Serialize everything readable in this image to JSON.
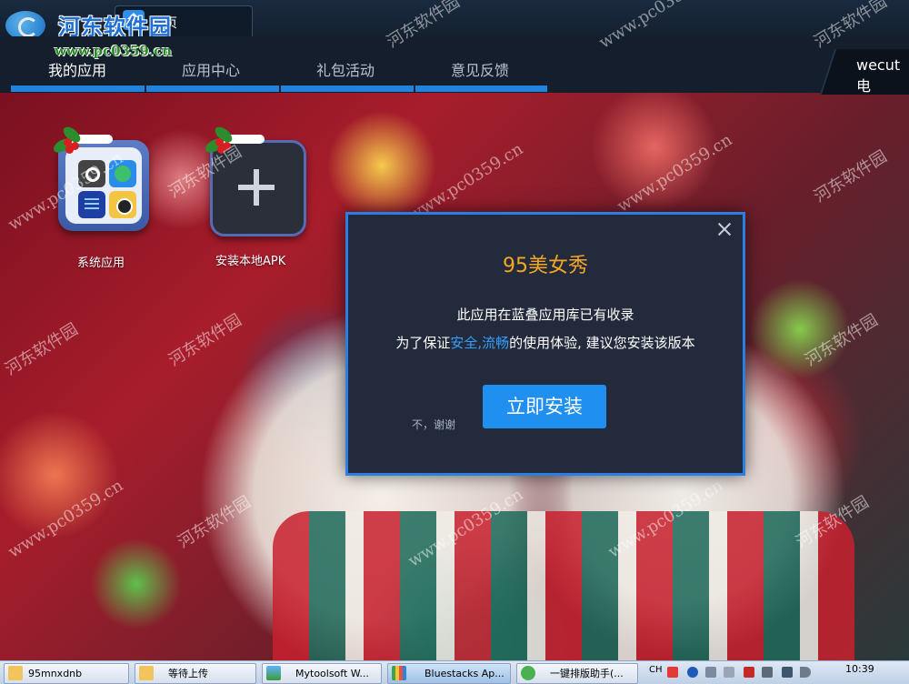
{
  "window": {
    "brand_logo_name": "bluestacks-logo",
    "home_tab_label": "首页"
  },
  "watermark": {
    "site_name": "河东软件园",
    "site_url": "www.pc0359.cn",
    "diagonal_name": "河东软件园",
    "diagonal_url": "www.pc0359.cn"
  },
  "nav": {
    "items": [
      {
        "label": "我的应用",
        "active": true
      },
      {
        "label": "应用中心",
        "active": false
      },
      {
        "label": "礼包活动",
        "active": false
      },
      {
        "label": "意见反馈",
        "active": false
      }
    ],
    "right_label": "wecut电"
  },
  "apps": [
    {
      "label": "系统应用",
      "icon": "system-apps-icon"
    },
    {
      "label": "安装本地APK",
      "icon": "add-apk-icon"
    }
  ],
  "dialog": {
    "title": "95美女秀",
    "line1": "此应用在蓝叠应用库已有收录",
    "line2_prefix": "为了保证",
    "line2_highlight": "安全,流畅",
    "line2_suffix": "的使用体验, 建议您安装该版本",
    "decline_label": "不，谢谢",
    "install_label": "立即安装",
    "accent_color": "#f5a623",
    "button_color": "#1f8ff0"
  },
  "taskbar": {
    "tasks": [
      {
        "label": "95mnxdnb",
        "icon": "folder-icon"
      },
      {
        "label": "等待上传",
        "icon": "folder-icon"
      },
      {
        "label": "Mytoolsoft W...",
        "icon": "image-app-icon"
      },
      {
        "label": "Bluestacks Ap...",
        "icon": "bluestacks-icon"
      },
      {
        "label": "一键排版助手(...",
        "icon": "typeset-icon"
      }
    ],
    "tray": {
      "ime_label": "CH",
      "time": "10:39"
    }
  }
}
